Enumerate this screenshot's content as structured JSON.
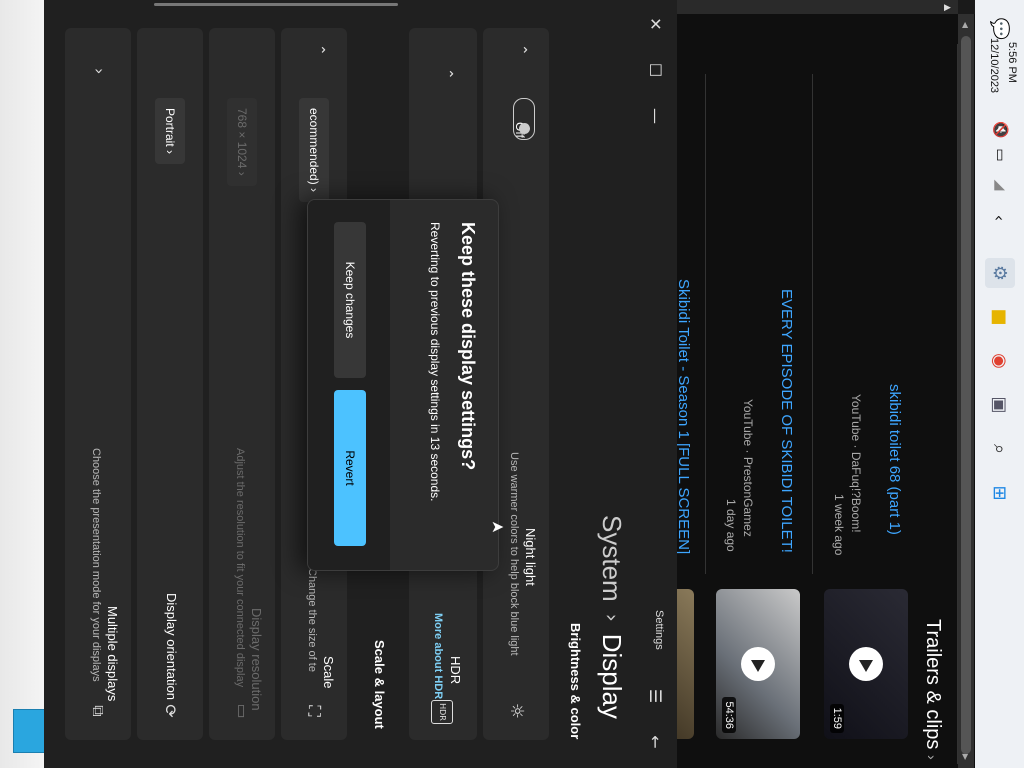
{
  "settings": {
    "app_name": "Settings",
    "breadcrumb_parent": "System",
    "breadcrumb_sep": "›",
    "page_title": "Display",
    "section_brightness": "Brightness & color",
    "night_light": {
      "title": "Night light",
      "subtitle": "Use warmer colors to help block blue light",
      "toggle_state": "Off"
    },
    "hdr": {
      "title": "HDR",
      "link": "More about HDR"
    },
    "section_scale": "Scale & layout",
    "scale": {
      "title": "Scale",
      "subtitle": "Change the size of te",
      "value": "ecommended)"
    },
    "resolution": {
      "title": "Display resolution",
      "subtitle": "Adjust the resolution to fit your connected display",
      "value": "768 × 1024"
    },
    "orientation": {
      "title": "Display orientation",
      "value": "Portrait"
    },
    "multiple": {
      "title": "Multiple displays",
      "subtitle": "Choose the presentation mode for your displays"
    }
  },
  "dialog": {
    "heading": "Keep these display settings?",
    "message": "Reverting to previous display settings in 13 seconds.",
    "keep_label": "Keep changes",
    "revert_label": "Revert"
  },
  "youtube": {
    "section_title": "Trailers & clips",
    "videos": [
      {
        "title": "skibidi toilet 68 (part 1)",
        "channel": "YouTube · DaFuq!?Boom!",
        "age": "1 week ago",
        "duration": "1:59"
      },
      {
        "title": "EVERY EPISODE OF SKIBIDI TOILET!",
        "channel": "YouTube · PrestonGamez",
        "age": "1 day ago",
        "duration": "54:36"
      },
      {
        "title": "Skibidi Toilet - Season 1 [FULL SCREEN]",
        "channel": "",
        "age": "",
        "duration": ""
      }
    ]
  },
  "taskbar": {
    "time": "5:56 PM",
    "date": "12/10/2023"
  },
  "colors": {
    "accent": "#4cc2ff",
    "link": "#3ea6ff"
  }
}
